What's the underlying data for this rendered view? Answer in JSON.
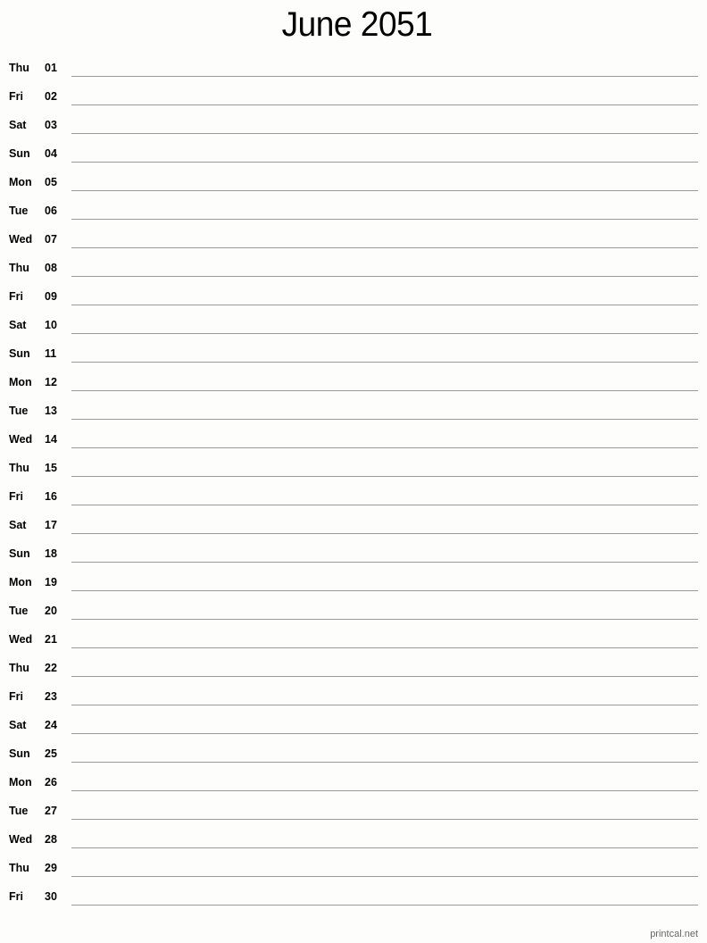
{
  "title": "June 2051",
  "days": [
    {
      "dow": "Thu",
      "num": "01"
    },
    {
      "dow": "Fri",
      "num": "02"
    },
    {
      "dow": "Sat",
      "num": "03"
    },
    {
      "dow": "Sun",
      "num": "04"
    },
    {
      "dow": "Mon",
      "num": "05"
    },
    {
      "dow": "Tue",
      "num": "06"
    },
    {
      "dow": "Wed",
      "num": "07"
    },
    {
      "dow": "Thu",
      "num": "08"
    },
    {
      "dow": "Fri",
      "num": "09"
    },
    {
      "dow": "Sat",
      "num": "10"
    },
    {
      "dow": "Sun",
      "num": "11"
    },
    {
      "dow": "Mon",
      "num": "12"
    },
    {
      "dow": "Tue",
      "num": "13"
    },
    {
      "dow": "Wed",
      "num": "14"
    },
    {
      "dow": "Thu",
      "num": "15"
    },
    {
      "dow": "Fri",
      "num": "16"
    },
    {
      "dow": "Sat",
      "num": "17"
    },
    {
      "dow": "Sun",
      "num": "18"
    },
    {
      "dow": "Mon",
      "num": "19"
    },
    {
      "dow": "Tue",
      "num": "20"
    },
    {
      "dow": "Wed",
      "num": "21"
    },
    {
      "dow": "Thu",
      "num": "22"
    },
    {
      "dow": "Fri",
      "num": "23"
    },
    {
      "dow": "Sat",
      "num": "24"
    },
    {
      "dow": "Sun",
      "num": "25"
    },
    {
      "dow": "Mon",
      "num": "26"
    },
    {
      "dow": "Tue",
      "num": "27"
    },
    {
      "dow": "Wed",
      "num": "28"
    },
    {
      "dow": "Thu",
      "num": "29"
    },
    {
      "dow": "Fri",
      "num": "30"
    }
  ],
  "footer": "printcal.net",
  "colors": {
    "background": "#fdfefc",
    "line": "#9a9a9a",
    "footer_text": "#666666"
  }
}
